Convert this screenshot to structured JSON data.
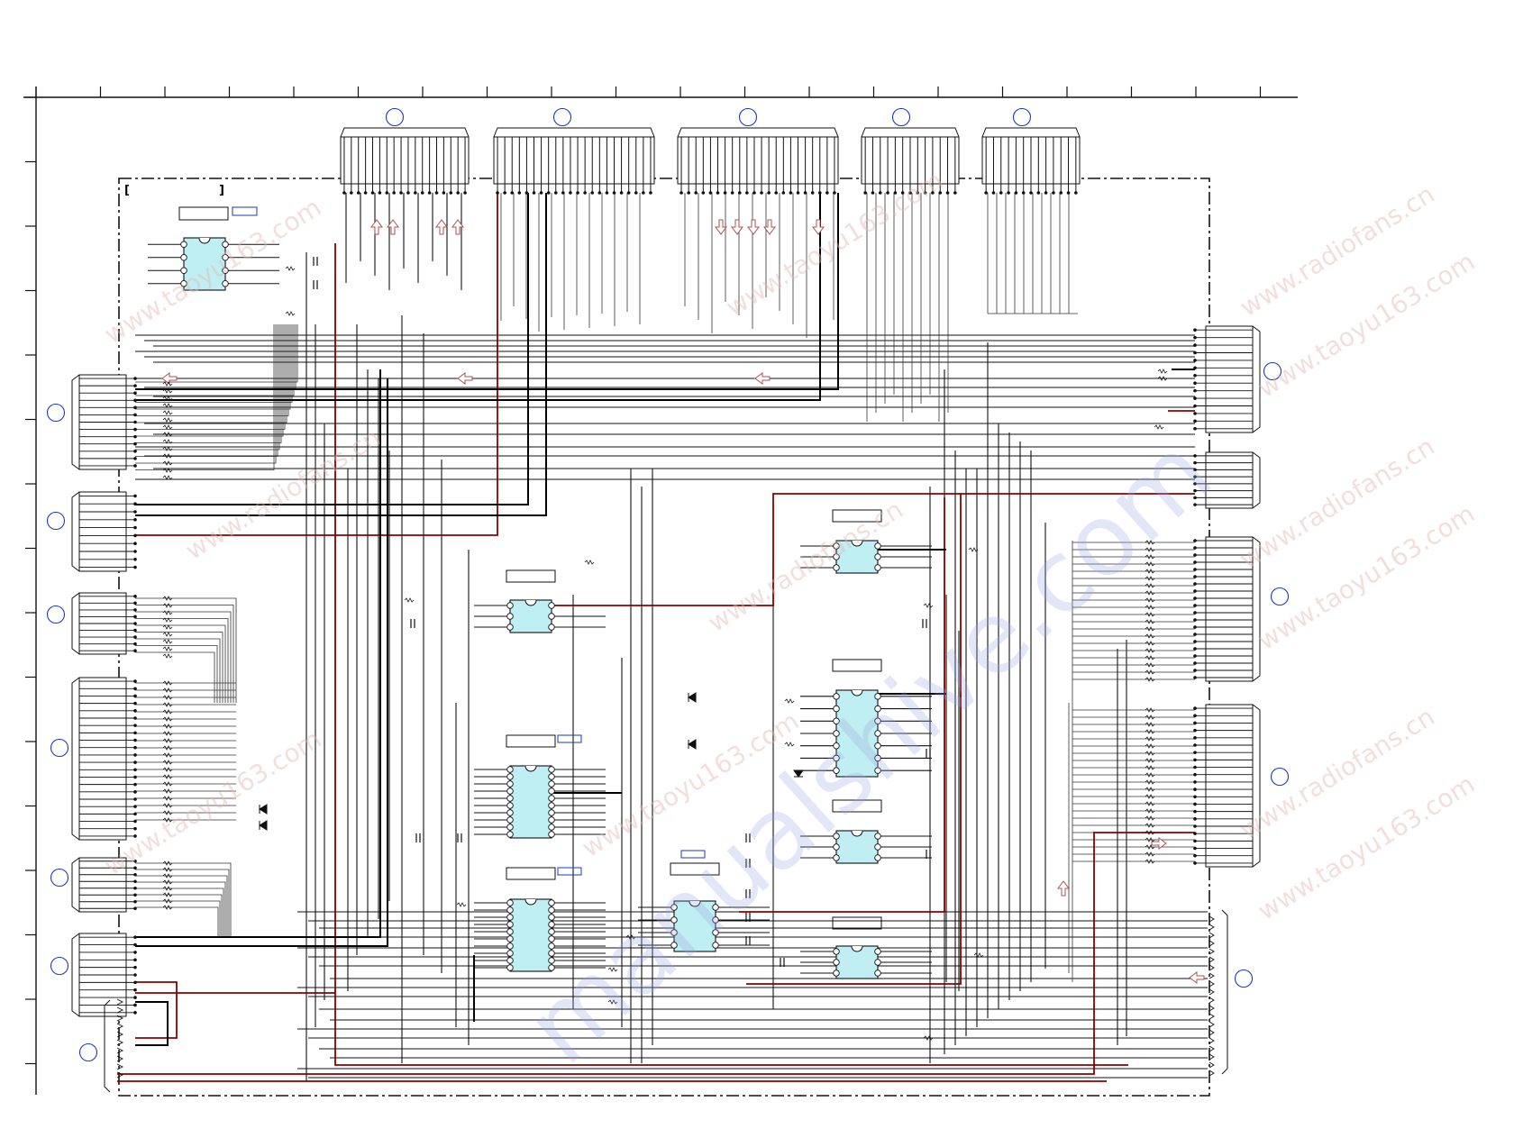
{
  "watermark": {
    "main": "manualshive.com",
    "tiles": [
      "www.radiofans.cn",
      "www.taoyu163.com"
    ]
  },
  "colors": {
    "wire": "#111111",
    "power_wire": "#8b0000",
    "ic_fill": "#bfeff2",
    "arrow": "#b05050",
    "label_box": "#1a3bbf",
    "callout": "#1a3bbf",
    "dashdot": "#111111"
  }
}
